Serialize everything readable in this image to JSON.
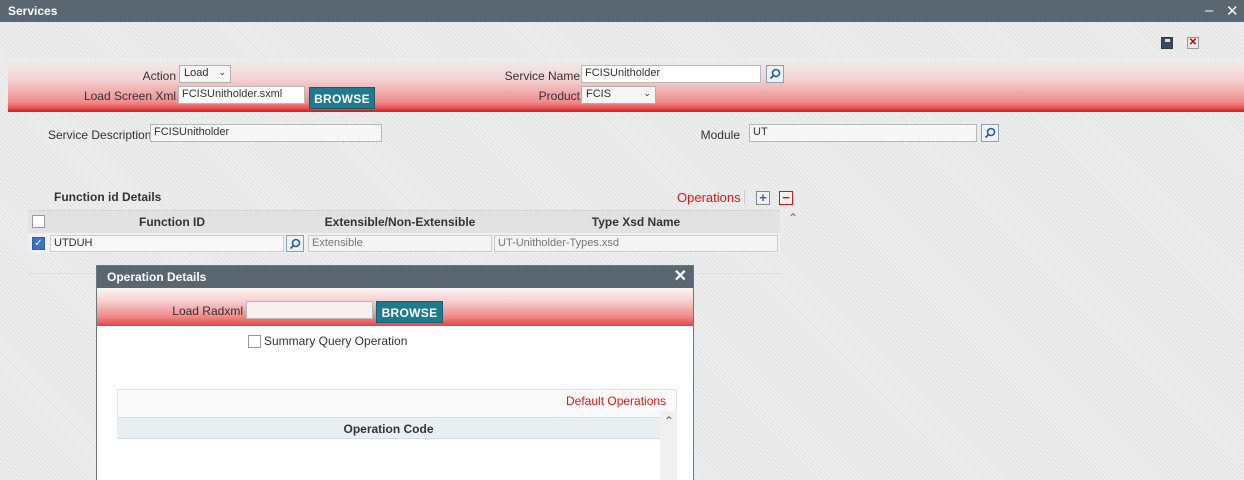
{
  "window": {
    "title": "Services",
    "minimize": "–",
    "close": "✕"
  },
  "header": {
    "action_label": "Action",
    "action_value": "Load",
    "load_screen_label": "Load Screen Xml",
    "load_screen_value": "FCISUnitholder.sxml",
    "browse_label": "BROWSE",
    "service_name_label": "Service Name",
    "service_name_value": "FCISUnitholder",
    "product_label": "Product",
    "product_value": "FCIS"
  },
  "body": {
    "service_desc_label": "Service Description",
    "service_desc_value": "FCISUnitholder",
    "module_label": "Module",
    "module_value": "UT"
  },
  "function_grid": {
    "title": "Function id Details",
    "operations_label": "Operations",
    "add": "+",
    "remove": "−",
    "columns": [
      "Function ID",
      "Extensible/Non-Extensible",
      "Type Xsd Name"
    ],
    "rows": [
      {
        "function_id": "UTDUH",
        "extensible": "Extensible",
        "xsd": "UT-Unitholder-Types.xsd"
      }
    ]
  },
  "dialog": {
    "title": "Operation Details",
    "close": "✕",
    "load_radxml_label": "Load Radxml",
    "load_radxml_value": "",
    "browse_label": "BROWSE",
    "summary_label": "Summary Query Operation",
    "default_ops_label": "Default Operations",
    "column": "Operation Code"
  },
  "colors": {
    "accent_red": "#e11111",
    "title_bar": "#5a6770",
    "browse": "#1e7a8c"
  }
}
